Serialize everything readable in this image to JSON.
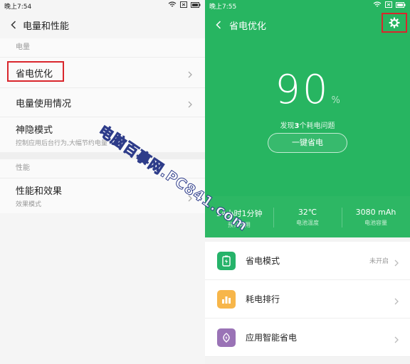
{
  "left": {
    "status": {
      "time": "晚上7:54"
    },
    "header": {
      "title": "电量和性能"
    },
    "section1": {
      "label": "电量"
    },
    "items1": [
      {
        "title": "省电优化",
        "sub": ""
      },
      {
        "title": "电量使用情况",
        "sub": ""
      },
      {
        "title": "神隐模式",
        "sub": "控制应用后台行为,大幅节约电量"
      }
    ],
    "section2": {
      "label": "性能"
    },
    "items2": [
      {
        "title": "性能和效果",
        "sub": "效果模式"
      }
    ]
  },
  "right": {
    "status": {
      "time": "晚上7:55"
    },
    "header": {
      "title": "省电优化"
    },
    "battery": {
      "percent": "90",
      "unit": "%"
    },
    "issues": {
      "prefix": "发现",
      "count": "3",
      "suffix": "个耗电问题"
    },
    "one_click_label": "一键省电",
    "stats": [
      {
        "value": "14小时1分钟",
        "label": "预计可用"
      },
      {
        "value": "32℃",
        "label": "电池温度"
      },
      {
        "value": "3080 mAh",
        "label": "电池容量"
      }
    ],
    "list": [
      {
        "label": "省电模式",
        "status": "未开启",
        "icon": "battery-icon",
        "color": "#26b36a"
      },
      {
        "label": "耗电排行",
        "status": "",
        "icon": "bar-chart-icon",
        "color": "#f7b64a"
      },
      {
        "label": "应用智能省电",
        "status": "",
        "icon": "leaf-icon",
        "color": "#9a73b6"
      }
    ]
  },
  "watermark": "电脑百事网.PC841.com",
  "colors": {
    "green": "#27b561",
    "highlight": "#d9262c"
  }
}
